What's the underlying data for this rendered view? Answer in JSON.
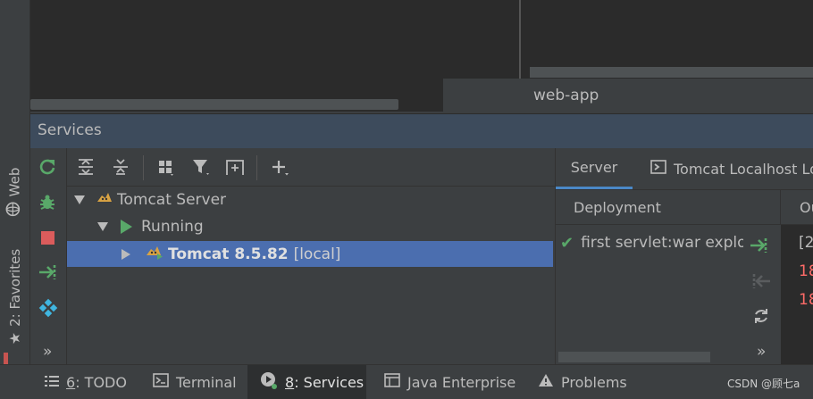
{
  "stripe": {
    "web_label": "Web",
    "favorites_label": "2: Favorites"
  },
  "editor": {
    "module_label": "web-app"
  },
  "services": {
    "title": "Services",
    "tree": {
      "root": "Tomcat Server",
      "status": "Running",
      "instance_name": "Tomcat 8.5.82",
      "instance_suffix": "[local]"
    },
    "more_label": "»"
  },
  "right_panel": {
    "tabs": [
      "Server",
      "Tomcat Localhost Lo"
    ],
    "deployment_header": "Deployment",
    "output_header": "Ou",
    "deployment_item": "first servlet:war explo",
    "log_lines": [
      "[2",
      "18",
      "18"
    ],
    "more_label": "»"
  },
  "bottom_bar": {
    "tabs": [
      {
        "num": "6",
        "label": ": TODO"
      },
      {
        "num": "",
        "label": "Terminal"
      },
      {
        "num": "8",
        "label": ": Services"
      },
      {
        "num": "",
        "label": "Java Enterprise"
      },
      {
        "num": "",
        "label": "Problems"
      }
    ],
    "watermark": "CSDN @顾七a"
  },
  "colors": {
    "selection": "#4b6eaf",
    "green": "#59a869",
    "red": "#db5c5c",
    "error_text": "#ff6b68"
  }
}
